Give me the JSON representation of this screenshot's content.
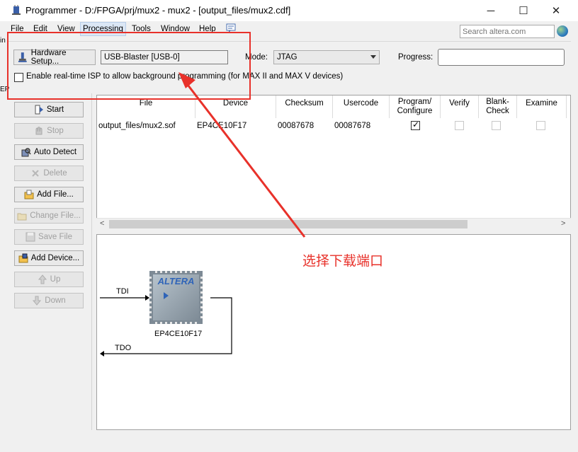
{
  "window": {
    "title": "Programmer - D:/FPGA/prj/mux2 - mux2 - [output_files/mux2.cdf]",
    "minimize_glyph": "─",
    "maximize_glyph": "☐",
    "close_glyph": "✕"
  },
  "menu": {
    "items": [
      "File",
      "Edit",
      "View",
      "Processing",
      "Tools",
      "Window",
      "Help"
    ],
    "highlighted": "Processing"
  },
  "search": {
    "placeholder": "Search altera.com"
  },
  "left_fragments": [
    "in",
    "EP"
  ],
  "hardware": {
    "setup_button": "Hardware Setup...",
    "current_hardware": "USB-Blaster [USB-0]",
    "mode_label": "Mode:",
    "mode_value": "JTAG",
    "progress_label": "Progress:",
    "isp_label": "Enable real-time ISP to allow background programming (for MAX II and MAX V devices)"
  },
  "sidebar": {
    "buttons": [
      {
        "label": "Start",
        "enabled": true
      },
      {
        "label": "Stop",
        "enabled": false
      },
      {
        "label": "Auto Detect",
        "enabled": true
      },
      {
        "label": "Delete",
        "enabled": false
      },
      {
        "label": "Add File...",
        "enabled": true
      },
      {
        "label": "Change File...",
        "enabled": false
      },
      {
        "label": "Save File",
        "enabled": false
      },
      {
        "label": "Add Device...",
        "enabled": true
      },
      {
        "label": "Up",
        "enabled": false
      },
      {
        "label": "Down",
        "enabled": false
      }
    ]
  },
  "table": {
    "headers": {
      "file": "File",
      "device": "Device",
      "checksum": "Checksum",
      "usercode": "Usercode",
      "program": "Program/ Configure",
      "verify": "Verify",
      "blank": "Blank- Check",
      "examine": "Examine"
    },
    "rows": [
      {
        "file": "output_files/mux2.sof",
        "device": "EP4CE10F17",
        "checksum": "00087678",
        "usercode": "00087678",
        "program": true,
        "verify": false,
        "blank": false,
        "examine": false
      }
    ]
  },
  "chain": {
    "tdi": "TDI",
    "tdo": "TDO",
    "device_name": "EP4CE10F17",
    "logo_text": "ALTERA"
  },
  "annotation": {
    "text": "选择下载端口",
    "color": "#e8312a"
  }
}
